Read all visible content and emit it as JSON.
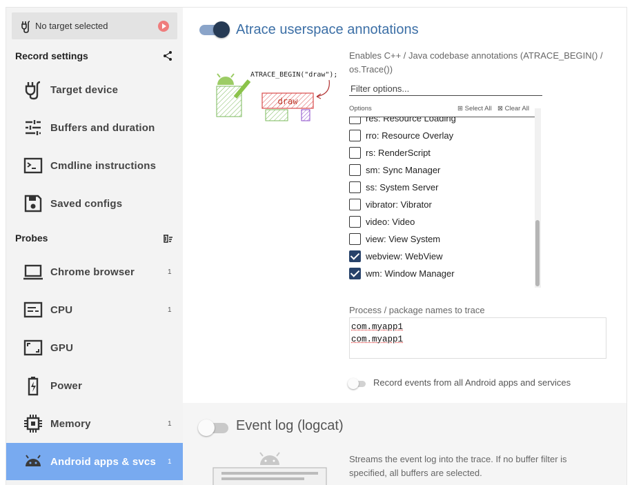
{
  "target": {
    "label": "No target selected"
  },
  "sidebar": {
    "record_settings_title": "Record settings",
    "probes_title": "Probes",
    "record_items": [
      {
        "label": "Target device",
        "icon": "usb-plug-icon"
      },
      {
        "label": "Buffers and duration",
        "icon": "tune-sliders-icon"
      },
      {
        "label": "Cmdline instructions",
        "icon": "terminal-icon"
      },
      {
        "label": "Saved configs",
        "icon": "floppy-save-icon"
      }
    ],
    "probe_items": [
      {
        "label": "Chrome browser",
        "count": "1",
        "icon": "laptop-icon"
      },
      {
        "label": "CPU",
        "count": "1",
        "icon": "cpu-list-icon"
      },
      {
        "label": "GPU",
        "count": "",
        "icon": "gpu-icon"
      },
      {
        "label": "Power",
        "count": "",
        "icon": "battery-charging-icon"
      },
      {
        "label": "Memory",
        "count": "1",
        "icon": "memory-chip-icon"
      },
      {
        "label": "Android apps & svcs",
        "count": "1",
        "icon": "android-icon",
        "active": true
      }
    ]
  },
  "atrace": {
    "enabled": true,
    "title": "Atrace userspace annotations",
    "description": "Enables C++ / Java codebase annotations (ATRACE_BEGIN() / os.Trace())",
    "illustration_code": "ATRACE_BEGIN(\"draw\");",
    "illustration_box": "draw",
    "filter_placeholder": "Filter options...",
    "options_label": "Options",
    "select_all": "Select All",
    "clear_all": "Clear All",
    "options": [
      {
        "label": "res: Resource Loading",
        "checked": false
      },
      {
        "label": "rro: Resource Overlay",
        "checked": false
      },
      {
        "label": "rs: RenderScript",
        "checked": false
      },
      {
        "label": "sm: Sync Manager",
        "checked": false
      },
      {
        "label": "ss: System Server",
        "checked": false
      },
      {
        "label": "vibrator: Vibrator",
        "checked": false
      },
      {
        "label": "video: Video",
        "checked": false
      },
      {
        "label": "view: View System",
        "checked": false
      },
      {
        "label": "webview: WebView",
        "checked": true
      },
      {
        "label": "wm: Window Manager",
        "checked": true
      }
    ],
    "process_label": "Process / package names to trace",
    "process_lines": [
      "com.myapp1",
      "com.myapp1"
    ],
    "all_apps_label": "Record events from all Android apps and services"
  },
  "logcat": {
    "enabled": false,
    "title": "Event log (logcat)",
    "description": "Streams the event log into the trace. If no buffer filter is specified, all buffers are selected."
  },
  "colors": {
    "accent": "#3c6fa6",
    "active_nav": "#78aaf0",
    "toggle_knob_on": "#263a54",
    "record_button": "#ef7d7d"
  }
}
